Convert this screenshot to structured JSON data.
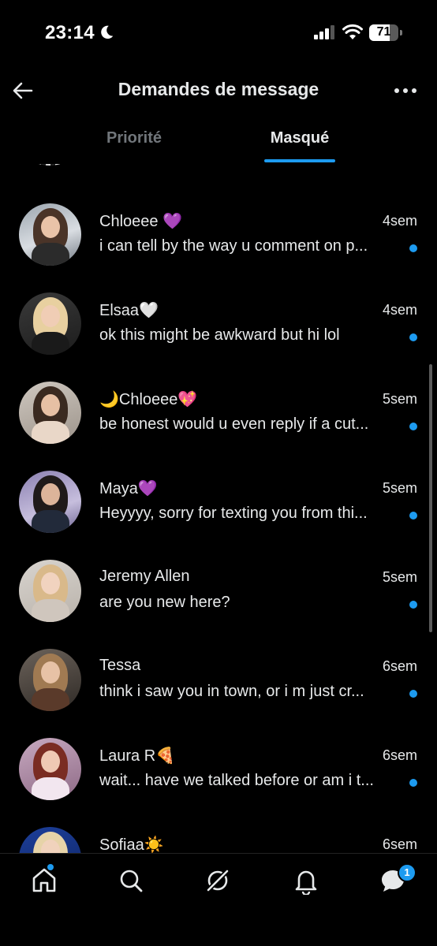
{
  "status_bar": {
    "time": "23:14",
    "battery": "71",
    "battery_level": 0.71
  },
  "header": {
    "title": "Demandes de message",
    "back_icon": "arrow-left-icon",
    "more_icon": "more-horizontal-icon"
  },
  "tabs": [
    {
      "label": "Priorité",
      "active": false
    },
    {
      "label": "Masqué",
      "active": true
    }
  ],
  "conversations": [
    {
      "name": "Chloeee 💜",
      "age": "4sem",
      "preview": "i can tell by the way u comment on p...",
      "unread": true
    },
    {
      "name": "Elsaa🤍",
      "age": "4sem",
      "preview": "ok this might be awkward but hi lol",
      "unread": true
    },
    {
      "name": "🌙Chloeee💖",
      "age": "5sem",
      "preview": "be honest would u even reply if a cut...",
      "unread": true
    },
    {
      "name": "Maya💜",
      "age": "5sem",
      "preview": "Heyyyy, sorry for texting you from thi...",
      "unread": true
    },
    {
      "name": "Jeremy Allen",
      "age": "5sem",
      "preview": "are you new here?",
      "unread": true
    },
    {
      "name": "Tessa",
      "age": "6sem",
      "preview": "think i saw you in town, or i m just cr...",
      "unread": true
    },
    {
      "name": "Laura R🍕",
      "age": "6sem",
      "preview": "wait... have we talked before or am i t...",
      "unread": true
    },
    {
      "name": "Sofiaa☀️",
      "age": "6sem",
      "preview": "",
      "unread": false
    }
  ],
  "bottom_nav": {
    "items": [
      "home-icon",
      "search-icon",
      "grok-icon",
      "notifications-icon",
      "messages-icon"
    ],
    "messages_badge": "1"
  },
  "colors": {
    "accent": "#1d9bf0",
    "background": "#000000",
    "text": "#e7e9ea",
    "muted": "#71767b"
  }
}
